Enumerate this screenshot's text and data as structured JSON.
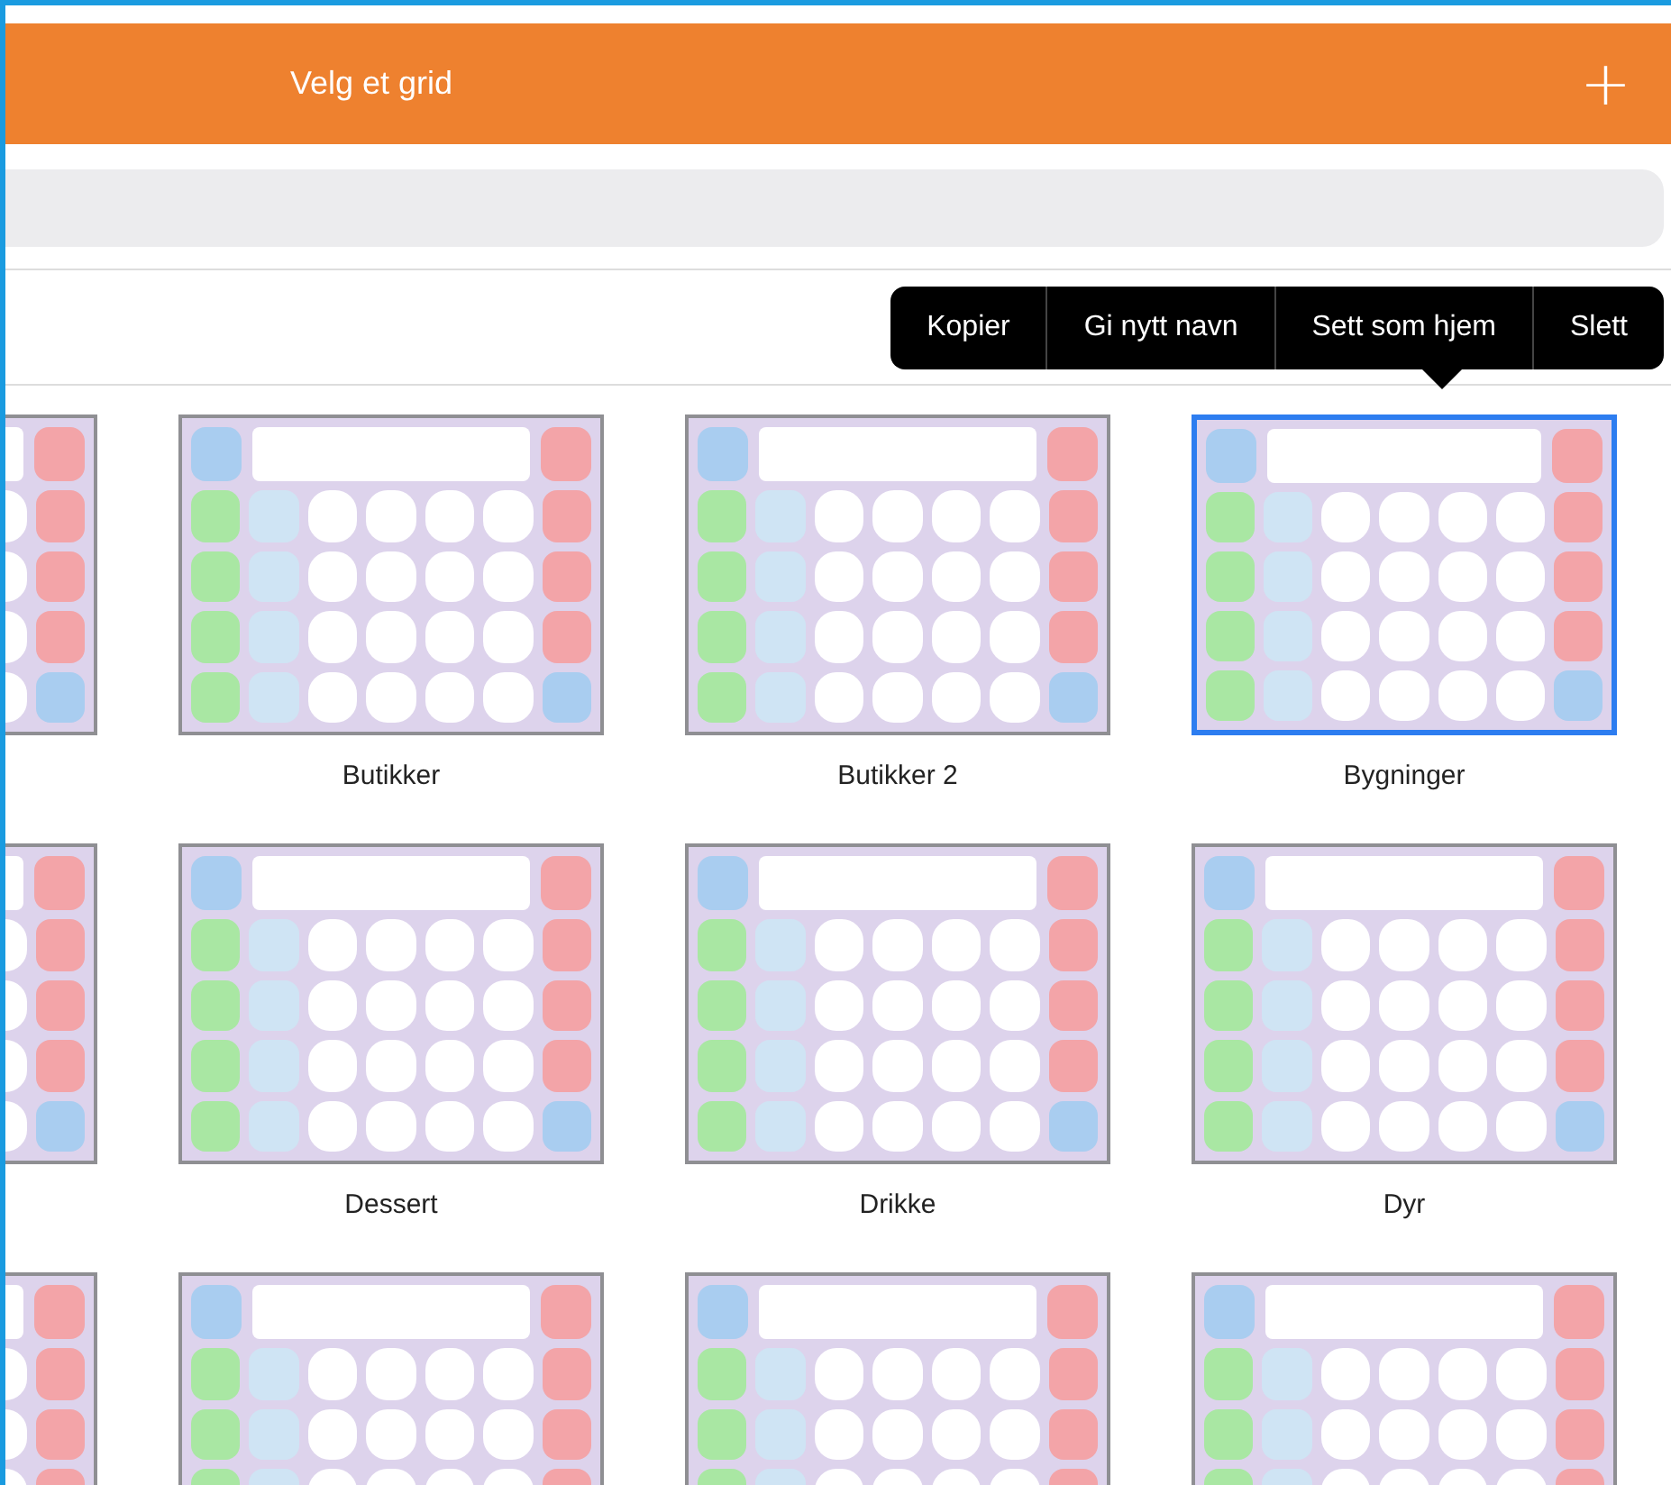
{
  "header": {
    "title": "Velg et grid",
    "add_button": "+"
  },
  "context_menu": {
    "items": [
      "Kopier",
      "Gi nytt navn",
      "Sett som hjem",
      "Slett"
    ]
  },
  "grids": [
    {
      "selected": false
    },
    {
      "name": "Butikker",
      "selected": false
    },
    {
      "name": "Butikker 2",
      "selected": false
    },
    {
      "name": "Bygninger",
      "selected": true
    },
    {
      "selected": false
    },
    {
      "name": "Dessert",
      "selected": false
    },
    {
      "name": "Drikke",
      "selected": false
    },
    {
      "name": "Dyr",
      "selected": false
    },
    {
      "selected": false
    },
    {
      "selected": false
    },
    {
      "selected": false
    },
    {
      "selected": false
    }
  ]
}
